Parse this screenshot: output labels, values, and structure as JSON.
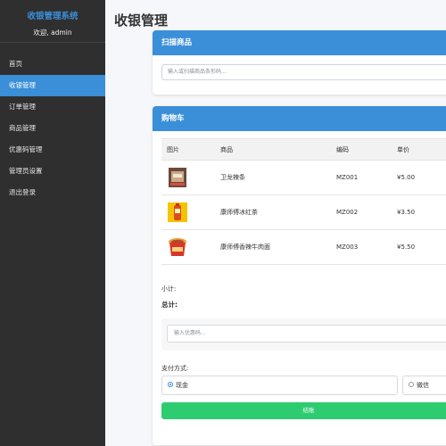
{
  "sidebar": {
    "title": "收银管理系统",
    "welcome": "欢迎, admin",
    "items": [
      {
        "label": "首页"
      },
      {
        "label": "收银管理"
      },
      {
        "label": "订单管理"
      },
      {
        "label": "商品管理"
      },
      {
        "label": "优惠码管理"
      },
      {
        "label": "管理员设置"
      },
      {
        "label": "退出登录"
      }
    ],
    "active_index": 1
  },
  "main": {
    "page_title": "收银管理",
    "scan": {
      "header": "扫描商品",
      "placeholder": "输入或扫描商品条形码..."
    },
    "cart": {
      "header": "购物车",
      "columns": [
        "图片",
        "商品",
        "编码",
        "单价"
      ],
      "rows": [
        {
          "name": "卫龙辣条",
          "code": "MZ001",
          "price": "¥5.00",
          "image_icon": "snack-package-icon"
        },
        {
          "name": "康师傅冰红茶",
          "code": "MZ002",
          "price": "¥3.50",
          "image_icon": "tea-drink-icon"
        },
        {
          "name": "康师傅香辣牛肉面",
          "code": "MZ003",
          "price": "¥5.50",
          "image_icon": "noodle-cup-icon"
        }
      ],
      "subtotal_label": "小计:",
      "total_label": "总计:",
      "coupon_placeholder": "输入优惠码...",
      "payment_label": "支付方式:",
      "payment_options": [
        {
          "label": "现金",
          "selected": true
        },
        {
          "label": "微信",
          "selected": false
        }
      ],
      "checkout_label": "结账"
    }
  },
  "colors": {
    "accent": "#3a8fd8",
    "sidebar_bg": "#2f2f2f",
    "checkout": "#2ecc71"
  }
}
